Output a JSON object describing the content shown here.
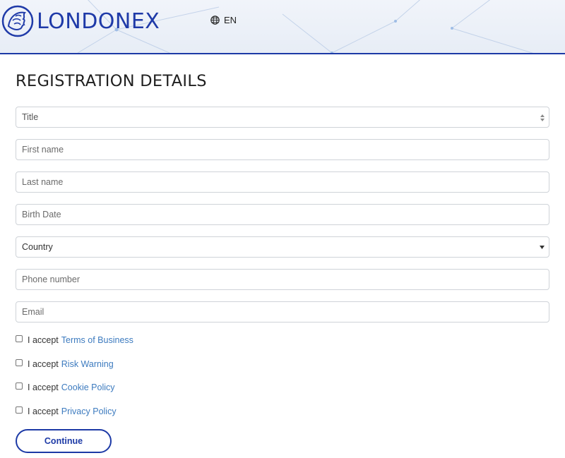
{
  "brand": {
    "name": "LONDONEX"
  },
  "language": {
    "label": "EN",
    "icon": "globe-icon"
  },
  "page": {
    "title": "REGISTRATION DETAILS"
  },
  "form": {
    "title_select": {
      "value": "Title"
    },
    "first_name": {
      "placeholder": "First name"
    },
    "last_name": {
      "placeholder": "Last name"
    },
    "birth_date": {
      "placeholder": "Birth Date"
    },
    "country_select": {
      "value": "Country"
    },
    "phone": {
      "placeholder": "Phone number"
    },
    "email": {
      "placeholder": "Email"
    }
  },
  "consents": [
    {
      "prefix": "I accept",
      "link": "Terms of Business"
    },
    {
      "prefix": "I accept",
      "link": "Risk Warning"
    },
    {
      "prefix": "I accept",
      "link": "Cookie Policy"
    },
    {
      "prefix": "I accept",
      "link": "Privacy Policy"
    }
  ],
  "actions": {
    "continue_label": "Continue"
  },
  "colors": {
    "brand": "#1d3aa6",
    "link": "#3d7bbf",
    "border": "#cfd3d8"
  }
}
